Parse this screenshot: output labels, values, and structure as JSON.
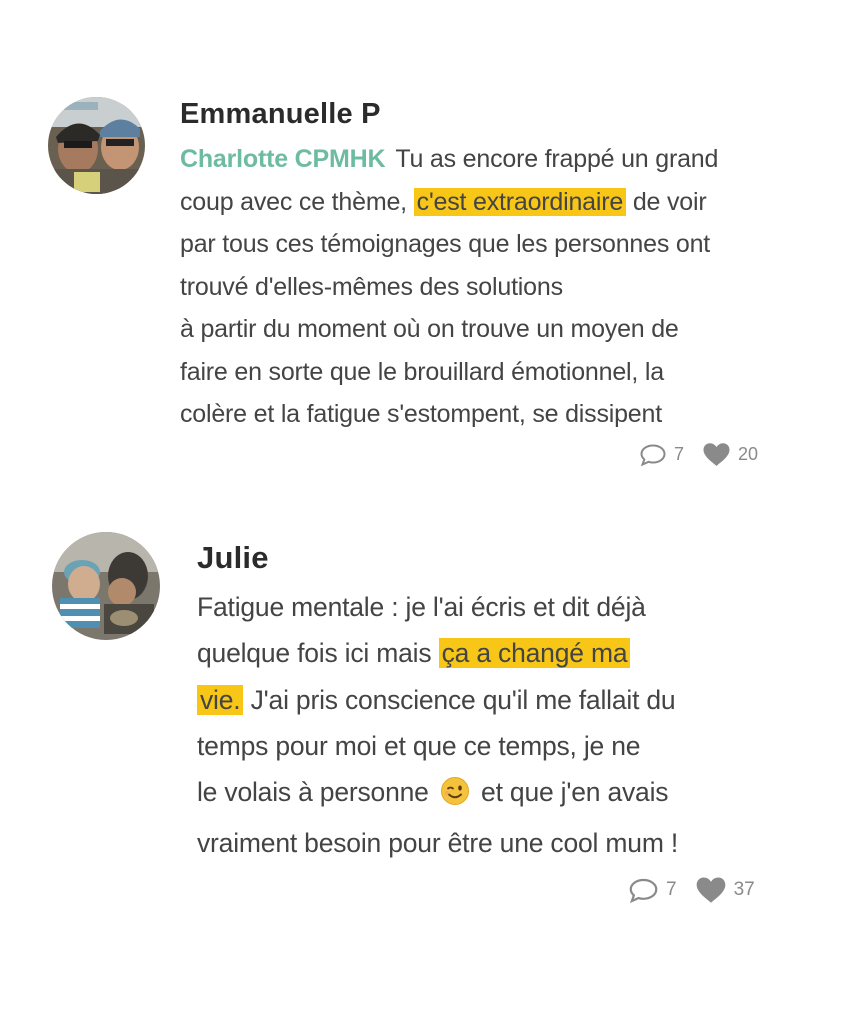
{
  "comments": [
    {
      "author": "Emmanuelle P",
      "mention": "Charlotte CPMHK",
      "lines": [
        {
          "before": "Tu as encore frappé un grand"
        },
        {
          "before": "coup avec ce thème, ",
          "highlight": "c'est extraordinaire",
          "after": " de voir"
        },
        {
          "before": "par tous ces témoignages que les personnes ont"
        },
        {
          "before": "trouvé d'elles-mêmes des solutions"
        },
        {
          "before": "à partir du moment où on trouve un moyen de"
        },
        {
          "before": "faire en sorte que le brouillard émotionnel, la"
        },
        {
          "before": "colère et la fatigue s'estompent, se dissipent"
        }
      ],
      "replies": "7",
      "likes": "20",
      "avatar_icon": "user-photo-avatar"
    },
    {
      "author": "Julie",
      "lines": [
        {
          "before": "Fatigue mentale : je l'ai écris et dit déjà"
        },
        {
          "before": "quelque fois ici mais ",
          "highlight": "ça a changé ma"
        },
        {
          "highlight": "vie.",
          "after": " J'ai pris conscience qu'il me fallait du"
        },
        {
          "before": "temps pour moi et que ce temps, je ne"
        },
        {
          "before": "le volais à personne ",
          "emoji": "winking-face",
          "after": " et que j'en avais"
        },
        {
          "before": "vraiment besoin pour être une cool mum !"
        }
      ],
      "replies": "7",
      "likes": "37",
      "avatar_icon": "user-photo-avatar"
    }
  ],
  "colors": {
    "highlight": "#f7c617",
    "mention": "#6dbba0",
    "meta": "#8a8a8a"
  },
  "icons": {
    "reply": "speech-bubble-icon",
    "like": "heart-icon"
  }
}
